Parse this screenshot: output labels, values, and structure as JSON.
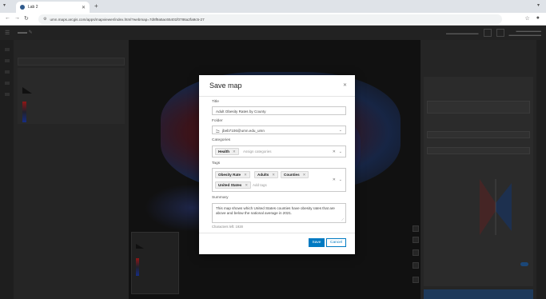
{
  "browser": {
    "tab_title": "Lab 2",
    "url": "umn.maps.arcgis.com/apps/mapviewer/index.html?webmap=7d8f9a5ac65401f0786a2fa9c5-27"
  },
  "modal": {
    "title": "Save map",
    "title_label": "Title",
    "title_value": "Adult Obesity Rates by County",
    "folder_label": "Folder",
    "folder_value": "jbeb7106@umn.edu_umn",
    "categories_label": "Categories",
    "category_chip": "Health",
    "categories_placeholder": "Assign categories",
    "tags_label": "Tags",
    "tags": [
      "Obesity Rate",
      "Adults",
      "Counties",
      "United States"
    ],
    "tags_placeholder": "Add tags",
    "summary_label": "Summary",
    "summary_value": "This map shows which United States counties have obesity rates that are above and below the national average in 2021.",
    "char_counter": "Characters left: 1928",
    "save_label": "Save",
    "cancel_label": "Cancel"
  }
}
